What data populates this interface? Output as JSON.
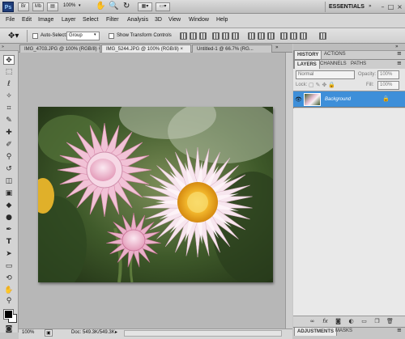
{
  "app": {
    "logo_text": "Ps",
    "zoom_value": "100%",
    "workspace_label": "ESSENTIALS",
    "window_controls": [
      "–",
      "□",
      "×"
    ]
  },
  "menu": [
    "File",
    "Edit",
    "Image",
    "Layer",
    "Select",
    "Filter",
    "Analysis",
    "3D",
    "View",
    "Window",
    "Help"
  ],
  "options_bar": {
    "auto_select_label": "Auto-Select:",
    "auto_select_value": "Group",
    "show_transform_label": "Show Transform Controls"
  },
  "document_tabs": [
    {
      "label": "IMG_4703.JPG @ 100% (RGB/8) ×"
    },
    {
      "label": "IMG_5244.JPG @ 100% (RGB/8) ×"
    },
    {
      "label": "Untitled-1 @ 66.7% (RG..."
    }
  ],
  "status_bar": {
    "zoom": "100%",
    "doc_info": "Doc: 549.3K/549.3K"
  },
  "panels": {
    "top_tabs": [
      "HISTORY",
      "ACTIONS"
    ],
    "layers_tabs": [
      "LAYERS",
      "CHANNELS",
      "PATHS"
    ],
    "blend_mode": "Normal",
    "opacity_label": "Opacity:",
    "opacity_value": "100%",
    "lock_label": "Lock:",
    "fill_label": "Fill:",
    "fill_value": "100%",
    "layer_name": "Background",
    "bottom_tabs": [
      "ADJUSTMENTS",
      "MASKS"
    ]
  },
  "colors": {
    "accent": "#3e8fd9",
    "chrome": "#d6d6d6",
    "canvas_bg": "#b7b7b7"
  }
}
